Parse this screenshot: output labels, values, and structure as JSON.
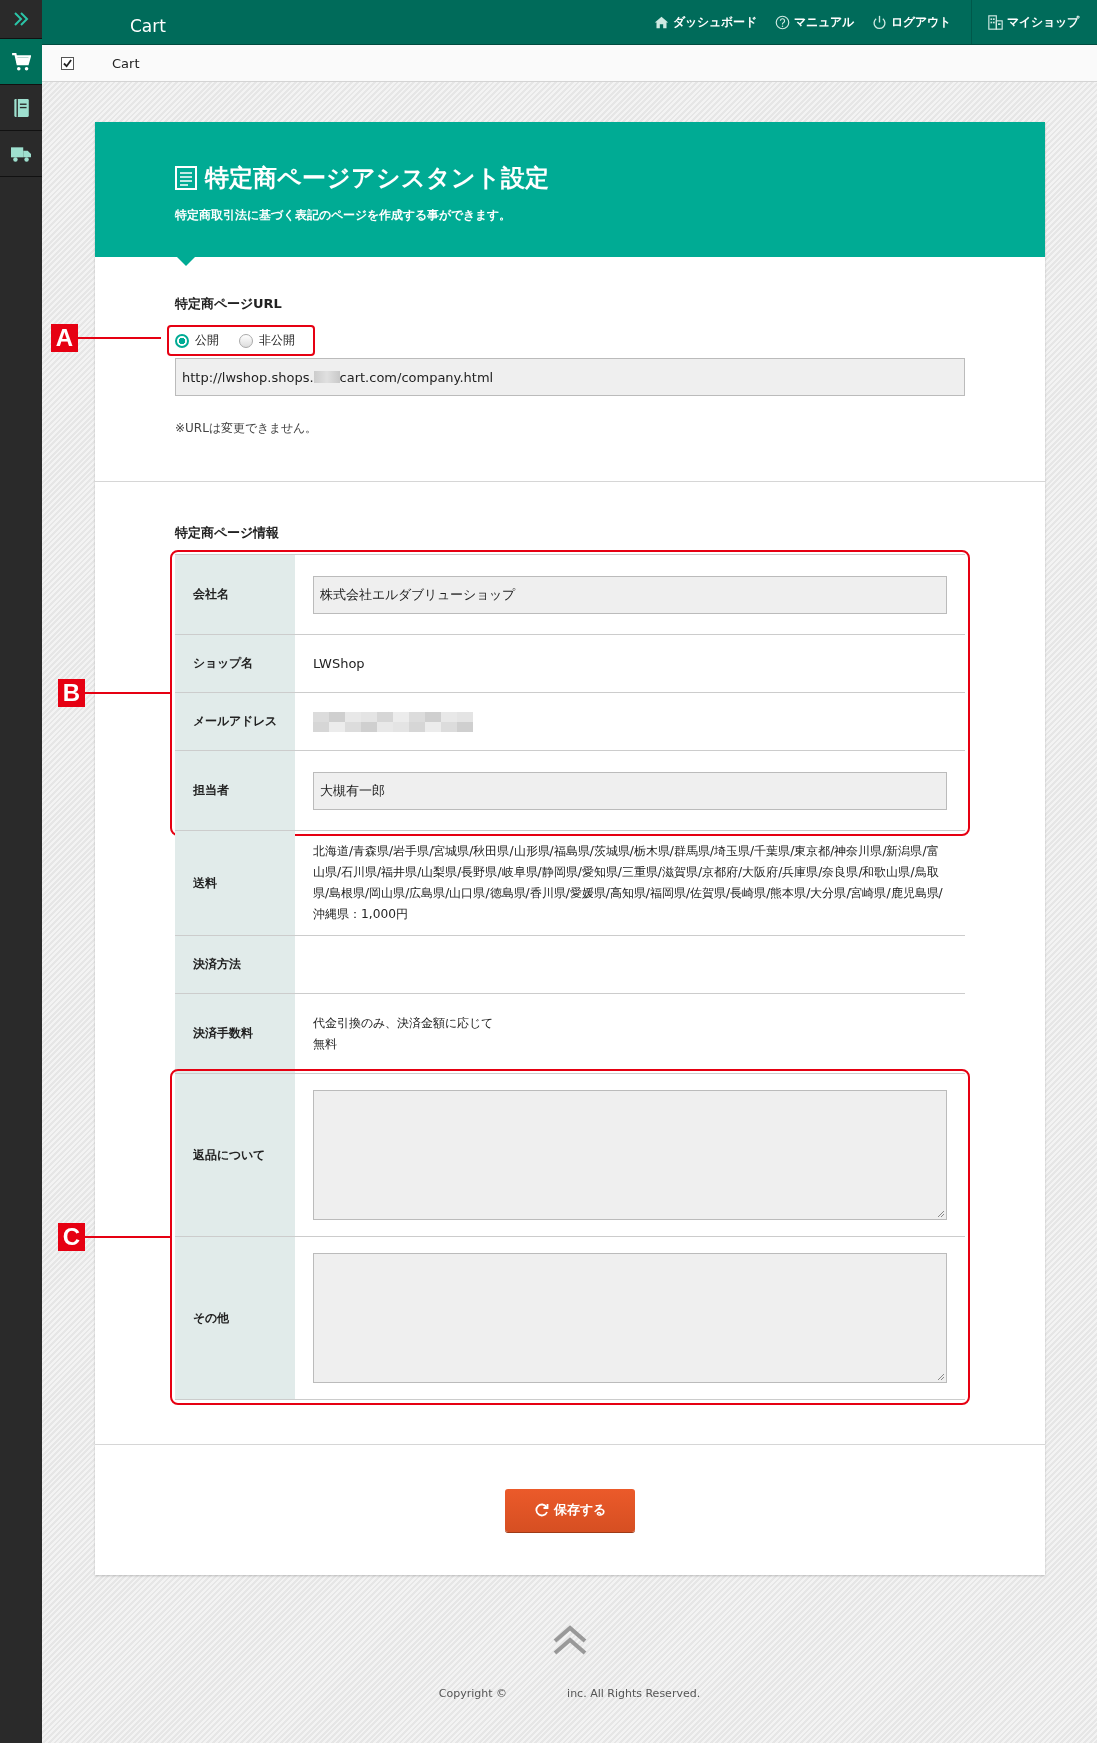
{
  "sidebar": {
    "items": [
      {
        "kind": "cart",
        "selected": true
      },
      {
        "kind": "book",
        "selected": false
      },
      {
        "kind": "truck",
        "selected": false
      }
    ]
  },
  "header": {
    "title": "Cart",
    "nav": [
      {
        "kind": "home",
        "label": "ダッシュボード"
      },
      {
        "kind": "help",
        "label": "マニュアル"
      },
      {
        "kind": "power",
        "label": "ログアウト"
      },
      {
        "kind": "building",
        "label": "マイショップ"
      }
    ]
  },
  "breadcrumb": {
    "checked": true,
    "label": "Cart"
  },
  "panel": {
    "title": "特定商ページアシスタント設定",
    "subtitle": "特定商取引法に基づく表記のページを作成する事ができます。"
  },
  "url_section": {
    "heading": "特定商ページURL",
    "annotation": "A",
    "visibility": [
      {
        "label": "公開",
        "selected": true
      },
      {
        "label": "非公開",
        "selected": false
      }
    ],
    "url": {
      "value_start": "http://lwshop.shops.",
      "value_end": "cart.com/company.html"
    },
    "note": "※URLは変更できません。"
  },
  "info_section": {
    "heading": "特定商ページ情報",
    "groups": [
      {
        "annotation": "B",
        "rows": [
          {
            "label": "会社名",
            "kind": "input",
            "value": "株式会社エルダブリューショップ"
          },
          {
            "label": "ショップ名",
            "kind": "text",
            "value": "LWShop"
          },
          {
            "label": "メールアドレス",
            "kind": "redacted"
          },
          {
            "label": "担当者",
            "kind": "input",
            "value": "大槻有一郎"
          }
        ]
      },
      {
        "rows": [
          {
            "label": "送料",
            "kind": "text",
            "value": "北海道/青森県/岩手県/宮城県/秋田県/山形県/福島県/茨城県/栃木県/群馬県/埼玉県/千葉県/東京都/神奈川県/新潟県/富山県/石川県/福井県/山梨県/長野県/岐阜県/静岡県/愛知県/三重県/滋賀県/京都府/大阪府/兵庫県/奈良県/和歌山県/鳥取県/島根県/岡山県/広島県/山口県/徳島県/香川県/愛媛県/高知県/福岡県/佐賀県/長崎県/熊本県/大分県/宮崎県/鹿児島県/沖縄県：1,000円"
          },
          {
            "label": "決済方法",
            "kind": "blank"
          },
          {
            "label": "決済手数料",
            "kind": "lines",
            "lines": [
              "代金引換のみ、決済金額に応じて",
              "無料"
            ]
          }
        ]
      },
      {
        "annotation": "C",
        "rows": [
          {
            "label": "返品について",
            "kind": "textarea"
          },
          {
            "label": "その他",
            "kind": "textarea"
          }
        ]
      }
    ]
  },
  "save_button": {
    "label": "保存する"
  },
  "footer": {
    "copyright_start": "Copyright ©",
    "copyright_end": "inc. All Rights Reserved."
  }
}
